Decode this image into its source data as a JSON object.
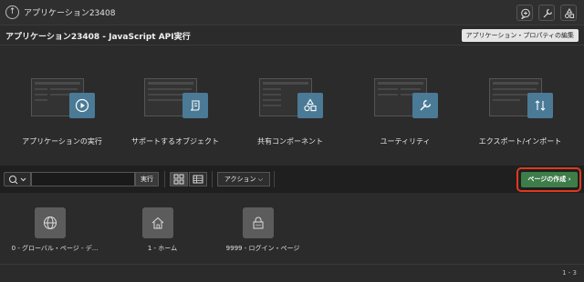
{
  "topbar": {
    "app_name": "アプリケーション23408",
    "icons": [
      "up-icon",
      "speech-bubble-plus-icon",
      "wrench-icon",
      "shapes-icon"
    ]
  },
  "header": {
    "title": "アプリケーション23408 - JavaScript API実行",
    "props_button": "アプリケーション・プロパティの編集"
  },
  "cards": [
    {
      "label": "アプリケーションの実行",
      "icon": "play-icon"
    },
    {
      "label": "サポートするオブジェクト",
      "icon": "scroll-icon"
    },
    {
      "label": "共有コンポーネント",
      "icon": "shapes-icon"
    },
    {
      "label": "ユーティリティ",
      "icon": "wrench-icon"
    },
    {
      "label": "エクスポート/インポート",
      "icon": "up-down-arrows-icon"
    }
  ],
  "toolbar": {
    "search_value": "",
    "run_label": "実行",
    "action_label": "アクション",
    "create_page_label": "ページの作成"
  },
  "pages": [
    {
      "label": "0 - グローバル・ページ - デ...",
      "icon": "globe-icon"
    },
    {
      "label": "1 - ホーム",
      "icon": "home-icon"
    },
    {
      "label": "9999 - ログイン・ページ",
      "icon": "lock-icon"
    }
  ],
  "pager": "1 - 3",
  "colors": {
    "accent_badge": "#4a7a96",
    "create_button": "#3e7d4a",
    "highlight_outline": "#e0391e"
  }
}
